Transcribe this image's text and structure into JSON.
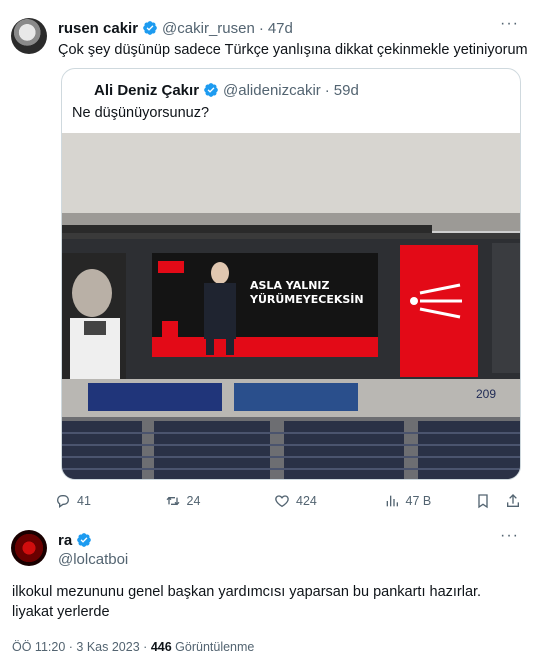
{
  "tweet": {
    "author_name": "rusen cakir",
    "author_handle": "@cakir_rusen",
    "separator": "·",
    "age": "47d",
    "text": "Çok şey düşünüp sadece Türkçe yanlışına dikkat çekinmekle yetiniyorum",
    "more_icon": "ellipsis-icon"
  },
  "quote": {
    "author_name": "Ali Deniz Çakır",
    "author_handle": "@alidenizcakir",
    "separator": "·",
    "age": "59d",
    "text": "Ne düşünüyorsunuz?",
    "banner_text_line1": "ASLA YALNIZ",
    "banner_text_line2": "YÜRÜMEYECEKSİN",
    "counter_text": "209"
  },
  "actions": {
    "replies": "41",
    "reposts": "24",
    "likes": "424",
    "views": "47 B"
  },
  "reply": {
    "author_name": "ra",
    "author_handle": "@lolcatboi",
    "text": "ilkokul mezununu genel başkan yardımcısı yaparsan bu pankartı hazırlar. liyakat yerlerde",
    "more_icon": "ellipsis-icon"
  },
  "footer": {
    "time": "ÖÖ 11:20",
    "separator": "·",
    "date": "3 Kas 2023",
    "separator2": "·",
    "views_count": "446",
    "views_label": "Görüntülenme"
  },
  "colors": {
    "verified_blue": "#1d9bf0",
    "text": "#0f1419",
    "muted": "#536471",
    "border": "#cfd9de",
    "party_red": "#e30a17"
  }
}
